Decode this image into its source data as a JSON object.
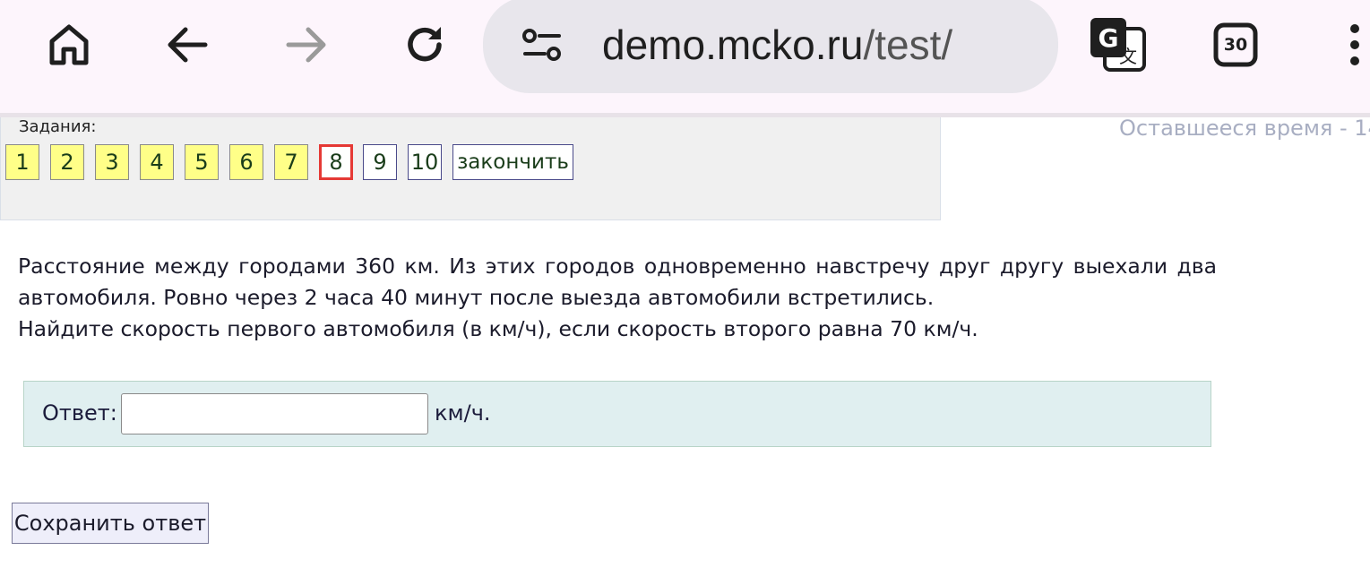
{
  "browser": {
    "url_host": "demo.mcko.ru",
    "url_path": "/test/",
    "tab_count": "30",
    "icons": [
      "home-icon",
      "back-icon",
      "forward-icon",
      "reload-icon",
      "site-settings-icon",
      "translate-icon",
      "tabs-icon",
      "more-menu-icon"
    ]
  },
  "tasks": {
    "label": "Задания:",
    "items": [
      {
        "label": "1",
        "state": "done"
      },
      {
        "label": "2",
        "state": "done"
      },
      {
        "label": "3",
        "state": "done"
      },
      {
        "label": "4",
        "state": "done"
      },
      {
        "label": "5",
        "state": "done"
      },
      {
        "label": "6",
        "state": "done"
      },
      {
        "label": "7",
        "state": "done"
      },
      {
        "label": "8",
        "state": "current"
      },
      {
        "label": "9",
        "state": "todo"
      },
      {
        "label": "10",
        "state": "todo"
      }
    ],
    "finish_label": "закончить"
  },
  "timer": {
    "text": "Оставшееся время - 14"
  },
  "question": {
    "line1": "Расстояние между городами 360 км. Из этих городов одновременно навстречу друг другу выехали два",
    "line2": "автомобиля. Ровно через 2 часа 40 минут после выезда автомобили встретились.",
    "line3": "Найдите скорость первого автомобиля (в км/ч), если скорость второго равна 70 км/ч."
  },
  "answer": {
    "label": "Ответ:",
    "value": "",
    "unit": "км/ч."
  },
  "save_label": "Сохранить ответ",
  "colors": {
    "done_task": "#ffff88",
    "current_task_border": "#e53935",
    "answer_bg": "#e0eff0"
  }
}
